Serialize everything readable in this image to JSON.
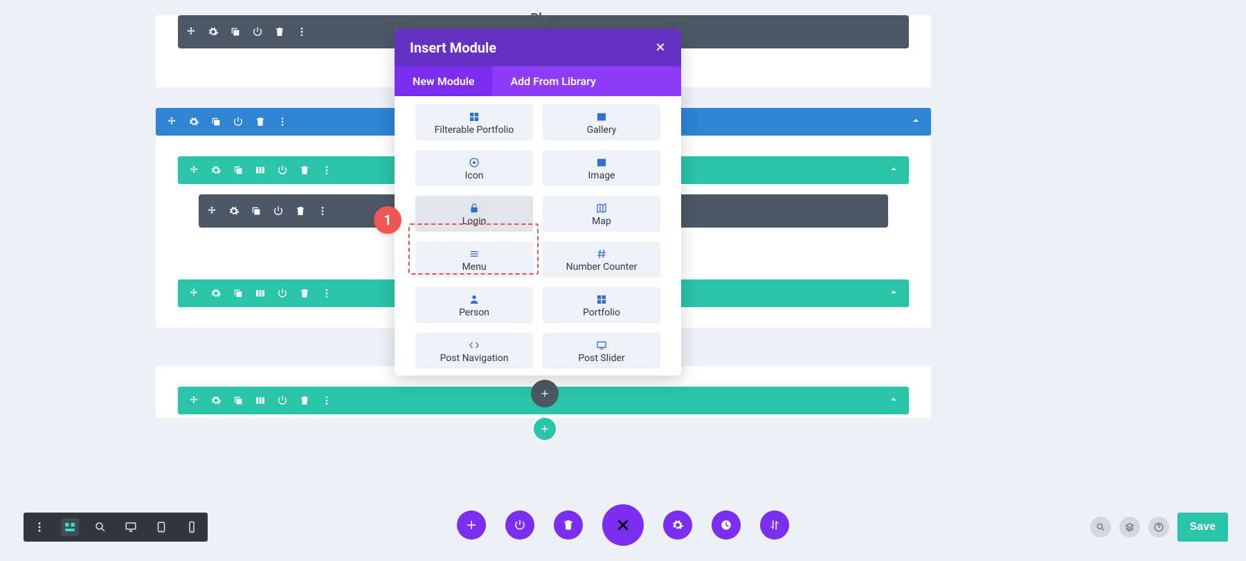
{
  "modal": {
    "title": "Insert Module",
    "tabs": [
      {
        "label": "New Module",
        "active": true
      },
      {
        "label": "Add From Library",
        "active": false
      }
    ],
    "badge": "1",
    "items": [
      {
        "name": "filterable-portfolio",
        "label": "Filterable Portfolio",
        "icon": "grid"
      },
      {
        "name": "gallery",
        "label": "Gallery",
        "icon": "image"
      },
      {
        "name": "icon",
        "label": "Icon",
        "icon": "target"
      },
      {
        "name": "image",
        "label": "Image",
        "icon": "image"
      },
      {
        "name": "login",
        "label": "Login",
        "icon": "lock",
        "hover": true,
        "highlight": true
      },
      {
        "name": "map",
        "label": "Map",
        "icon": "map"
      },
      {
        "name": "menu",
        "label": "Menu",
        "icon": "menu"
      },
      {
        "name": "number-counter",
        "label": "Number Counter",
        "icon": "hash"
      },
      {
        "name": "person",
        "label": "Person",
        "icon": "person"
      },
      {
        "name": "portfolio",
        "label": "Portfolio",
        "icon": "grid"
      },
      {
        "name": "post-navigation",
        "label": "Post Navigation",
        "icon": "leftright"
      },
      {
        "name": "post-slider",
        "label": "Post Slider",
        "icon": "slider"
      }
    ]
  },
  "sections": {
    "top_module_title": "Blog"
  },
  "bottombar": {
    "save": "Save"
  }
}
